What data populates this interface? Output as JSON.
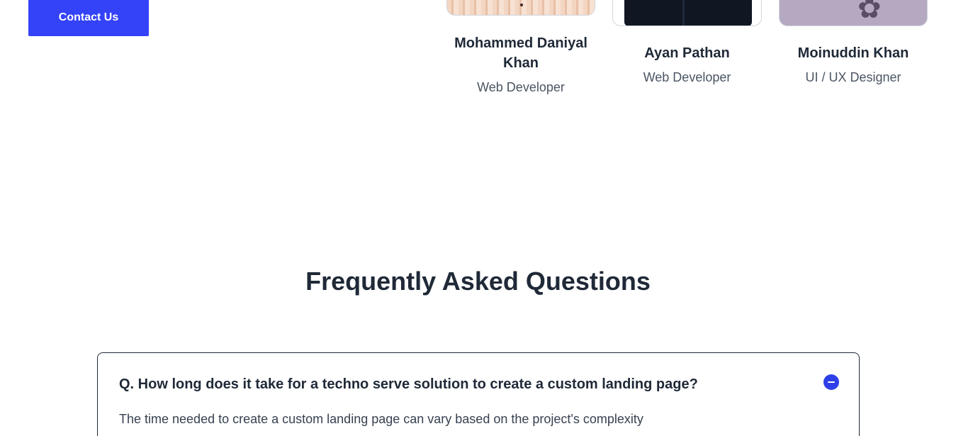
{
  "contact": {
    "label": "Contact Us"
  },
  "team": {
    "members": [
      {
        "name": "Mohammed Daniyal Khan",
        "role": "Web Developer"
      },
      {
        "name": "Ayan Pathan",
        "role": "Web Developer"
      },
      {
        "name": "Moinuddin Khan",
        "role": "UI / UX Designer"
      }
    ]
  },
  "faq": {
    "title": "Frequently Asked Questions",
    "items": [
      {
        "question": "Q. How long does it take for a techno serve solution to create a custom landing page?",
        "answer": "The time needed to create a custom landing page can vary based on the project's complexity"
      }
    ]
  },
  "colors": {
    "accent": "#3443f7",
    "text": "#1f2937",
    "muted": "#4b5563"
  },
  "icons": {
    "faq_toggle": "minus-circle-icon"
  }
}
